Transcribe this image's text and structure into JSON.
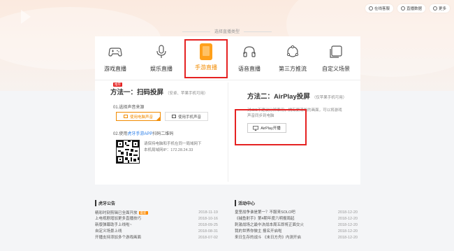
{
  "top_links": [
    {
      "label": "在线客服",
      "icon": "headset-icon"
    },
    {
      "label": "直播数据",
      "icon": "chart-icon"
    },
    {
      "label": "更多",
      "icon": "more-icon"
    }
  ],
  "type_title": "选择直播类型",
  "types": [
    {
      "label": "游戏直播",
      "icon": "gamepad-icon"
    },
    {
      "label": "娱乐直播",
      "icon": "microphone-icon"
    },
    {
      "label": "手游直播",
      "icon": "phone-icon",
      "active": true
    },
    {
      "label": "语音直播",
      "icon": "headphones-icon"
    },
    {
      "label": "第三方推流",
      "icon": "share-icon"
    },
    {
      "label": "自定义场景",
      "icon": "layers-icon"
    }
  ],
  "method1": {
    "badge": "推荐",
    "title": "方法一：扫码投屏",
    "subtitle": "（安卓、苹果手机可用）",
    "step1": "01.选择声音来源",
    "opt_computer": "使用电脑声音",
    "opt_phone": "使用手机声音",
    "step2_prefix": "02.使用",
    "step2_link": "虎牙手游APP",
    "step2_suffix": "扫码二维码",
    "qr_note": "请保持电脑和手机在同一局域网下",
    "ip_label": "本机局域网IP：172.28.24.33"
  },
  "method2": {
    "title": "方法二：AirPlay投屏",
    "subtitle": "（仅苹果手机可用）",
    "desc": "对iOS不建议分辨率用，拥有更清晰的画面，可以将游戏声音同步到电脑",
    "button": "AirPlay开播"
  },
  "announcements": {
    "title": "虎牙公告",
    "hot_label": "最新",
    "items": [
      {
        "text": "精彩时刻剪辑已全面开放",
        "date": "2018-11-19",
        "hot": true
      },
      {
        "text": "上电视剧增加更多直播技巧",
        "date": "2018-10-16"
      },
      {
        "text": "新版弹幕助手上线啦~",
        "date": "2018-09-25"
      },
      {
        "text": "自定义场景上线",
        "date": "2018-08-31"
      },
      {
        "text": "开播支持添加多个游戏画面",
        "date": "2018-07-02"
      }
    ]
  },
  "activities": {
    "title": "活动中心",
    "items": [
      {
        "text": "皇室战争谁是第一？不服来SOLO吧",
        "date": "2018-12-20"
      },
      {
        "text": "《捕鱼射手》第4期年度六明报周起",
        "date": "2018-12-20"
      },
      {
        "text": "刺激战场之最中决战本周五即将正面交火",
        "date": "2018-12-20"
      },
      {
        "text": "我的世界你做主 报名开启啦",
        "date": "2018-12-20"
      },
      {
        "text": "来日生存的战斗 《末日方舟》内测开启",
        "date": "2018-12-20"
      }
    ]
  }
}
